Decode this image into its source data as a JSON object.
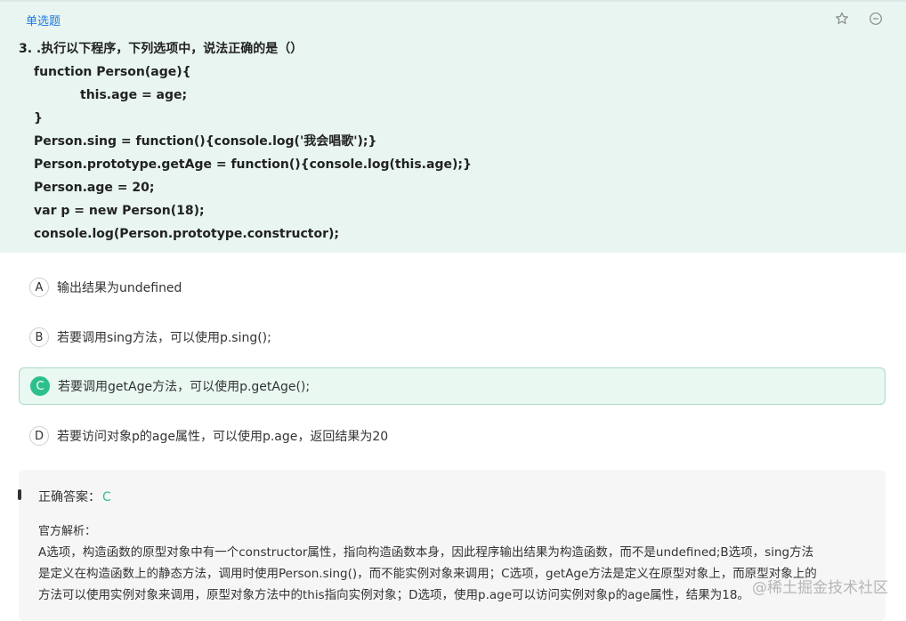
{
  "question": {
    "type_label": "单选题",
    "title": "3. .执行以下程序，下列选项中，说法正确的是（）",
    "code_lines": [
      "function Person(age){",
      "this.age = age;",
      "}",
      "Person.sing = function(){console.log('我会唱歌');}",
      "Person.prototype.getAge = function(){console.log(this.age);}",
      "Person.age = 20;",
      "var p = new Person(18);",
      "console.log(Person.prototype.constructor);"
    ],
    "icons": [
      "star-icon",
      "minus-circle-icon"
    ]
  },
  "options": [
    {
      "letter": "A",
      "text": "输出结果为undefined",
      "selected": false
    },
    {
      "letter": "B",
      "text": "若要调用sing方法，可以使用p.sing();",
      "selected": false
    },
    {
      "letter": "C",
      "text": "若要调用getAge方法，可以使用p.getAge();",
      "selected": true
    },
    {
      "letter": "D",
      "text": "若要访问对象p的age属性，可以使用p.age，返回结果为20",
      "selected": false
    }
  ],
  "analysis": {
    "answer_label": "正确答案：",
    "answer_value": "C",
    "explanation_label": "官方解析：",
    "explanation_lines": [
      "A选项，构造函数的原型对象中有一个constructor属性，指向构造函数本身，因此程序输出结果为构造函数，而不是undefined;B选项，sing方法",
      "是定义在构造函数上的静态方法，调用时使用Person.sing()，而不能实例对象来调用；C选项，getAge方法是定义在原型对象上，而原型对象上的",
      "方法可以使用实例对象来调用，原型对象方法中的this指向实例对象；D选项，使用p.age可以访问实例对象p的age属性，结果为18。"
    ]
  },
  "watermark": "@稀土掘金技术社区",
  "colors": {
    "accent_green": "#2dc08d",
    "question_bg": "#e8f5f1",
    "type_blue": "#1e7be0"
  }
}
